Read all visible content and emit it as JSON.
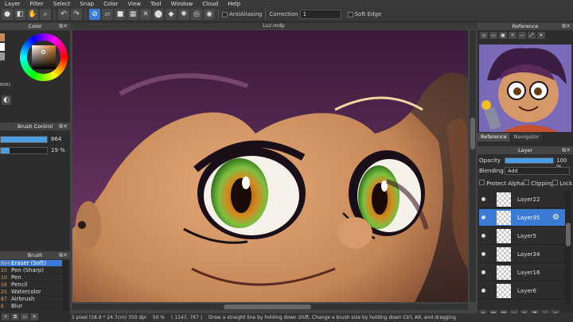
{
  "menu": [
    "Layer",
    "Filter",
    "Select",
    "Snap",
    "Color",
    "View",
    "Tool",
    "Window",
    "Cloud",
    "Help"
  ],
  "toolbar": {
    "antialiasing_label": "AntiAliasing",
    "correction_label": "Correction",
    "correction_value": "1",
    "soft_edge_label": "Soft Edge"
  },
  "color_panel": {
    "title": "Color",
    "hex_fragment": "BAB2"
  },
  "brush_control": {
    "title": "Brush Control",
    "size_value": "864",
    "size_fill": 1.0,
    "opacity_value": "19 %",
    "opacity_fill": 0.19
  },
  "brush_panel": {
    "title": "Brush",
    "items": [
      {
        "size": "864",
        "name": "Eraser (Soft)",
        "selected": true
      },
      {
        "size": "20",
        "name": "Pen (Sharp)",
        "selected": false
      },
      {
        "size": "10",
        "name": "Pen",
        "selected": false
      },
      {
        "size": "16",
        "name": "Pencil",
        "selected": false
      },
      {
        "size": "25",
        "name": "Watercolor",
        "selected": false
      },
      {
        "size": "87",
        "name": "Airbrush",
        "selected": false
      },
      {
        "size": "6",
        "name": "Blur",
        "selected": false
      }
    ]
  },
  "canvas": {
    "title": "Luz.mdp"
  },
  "reference": {
    "title": "Reference",
    "tabs": [
      "Reference",
      "Navigator"
    ]
  },
  "layer_panel": {
    "title": "Layer",
    "opacity_label": "Opacity",
    "opacity_value": "100 %",
    "opacity_fill": 1.0,
    "blending_label": "Blending",
    "blending_value": "Add",
    "protect_alpha": "Protect Alpha",
    "clipping": "Clipping",
    "lock": "Lock",
    "layers": [
      {
        "name": "Layer22",
        "selected": false
      },
      {
        "name": "Layer35",
        "selected": true
      },
      {
        "name": "Layer5",
        "selected": false
      },
      {
        "name": "Layer34",
        "selected": false
      },
      {
        "name": "Layer16",
        "selected": false
      },
      {
        "name": "Layer6",
        "selected": false
      }
    ]
  },
  "status": {
    "size": "1 pixel  (18.9 * 24.7cm)  350 dpi",
    "zoom": "50 %",
    "coords": "( 1147, 767 )",
    "hint": "Draw a straight line by holding down Shift. Change a brush size by holding down Ctrl, Alt, and dragging"
  },
  "colors": {
    "accent": "#3a7bd5",
    "panel": "#2d2d2d",
    "skin": "#c98a5a",
    "hair": "#5a2a50",
    "eye_green": "#4aa02a"
  }
}
